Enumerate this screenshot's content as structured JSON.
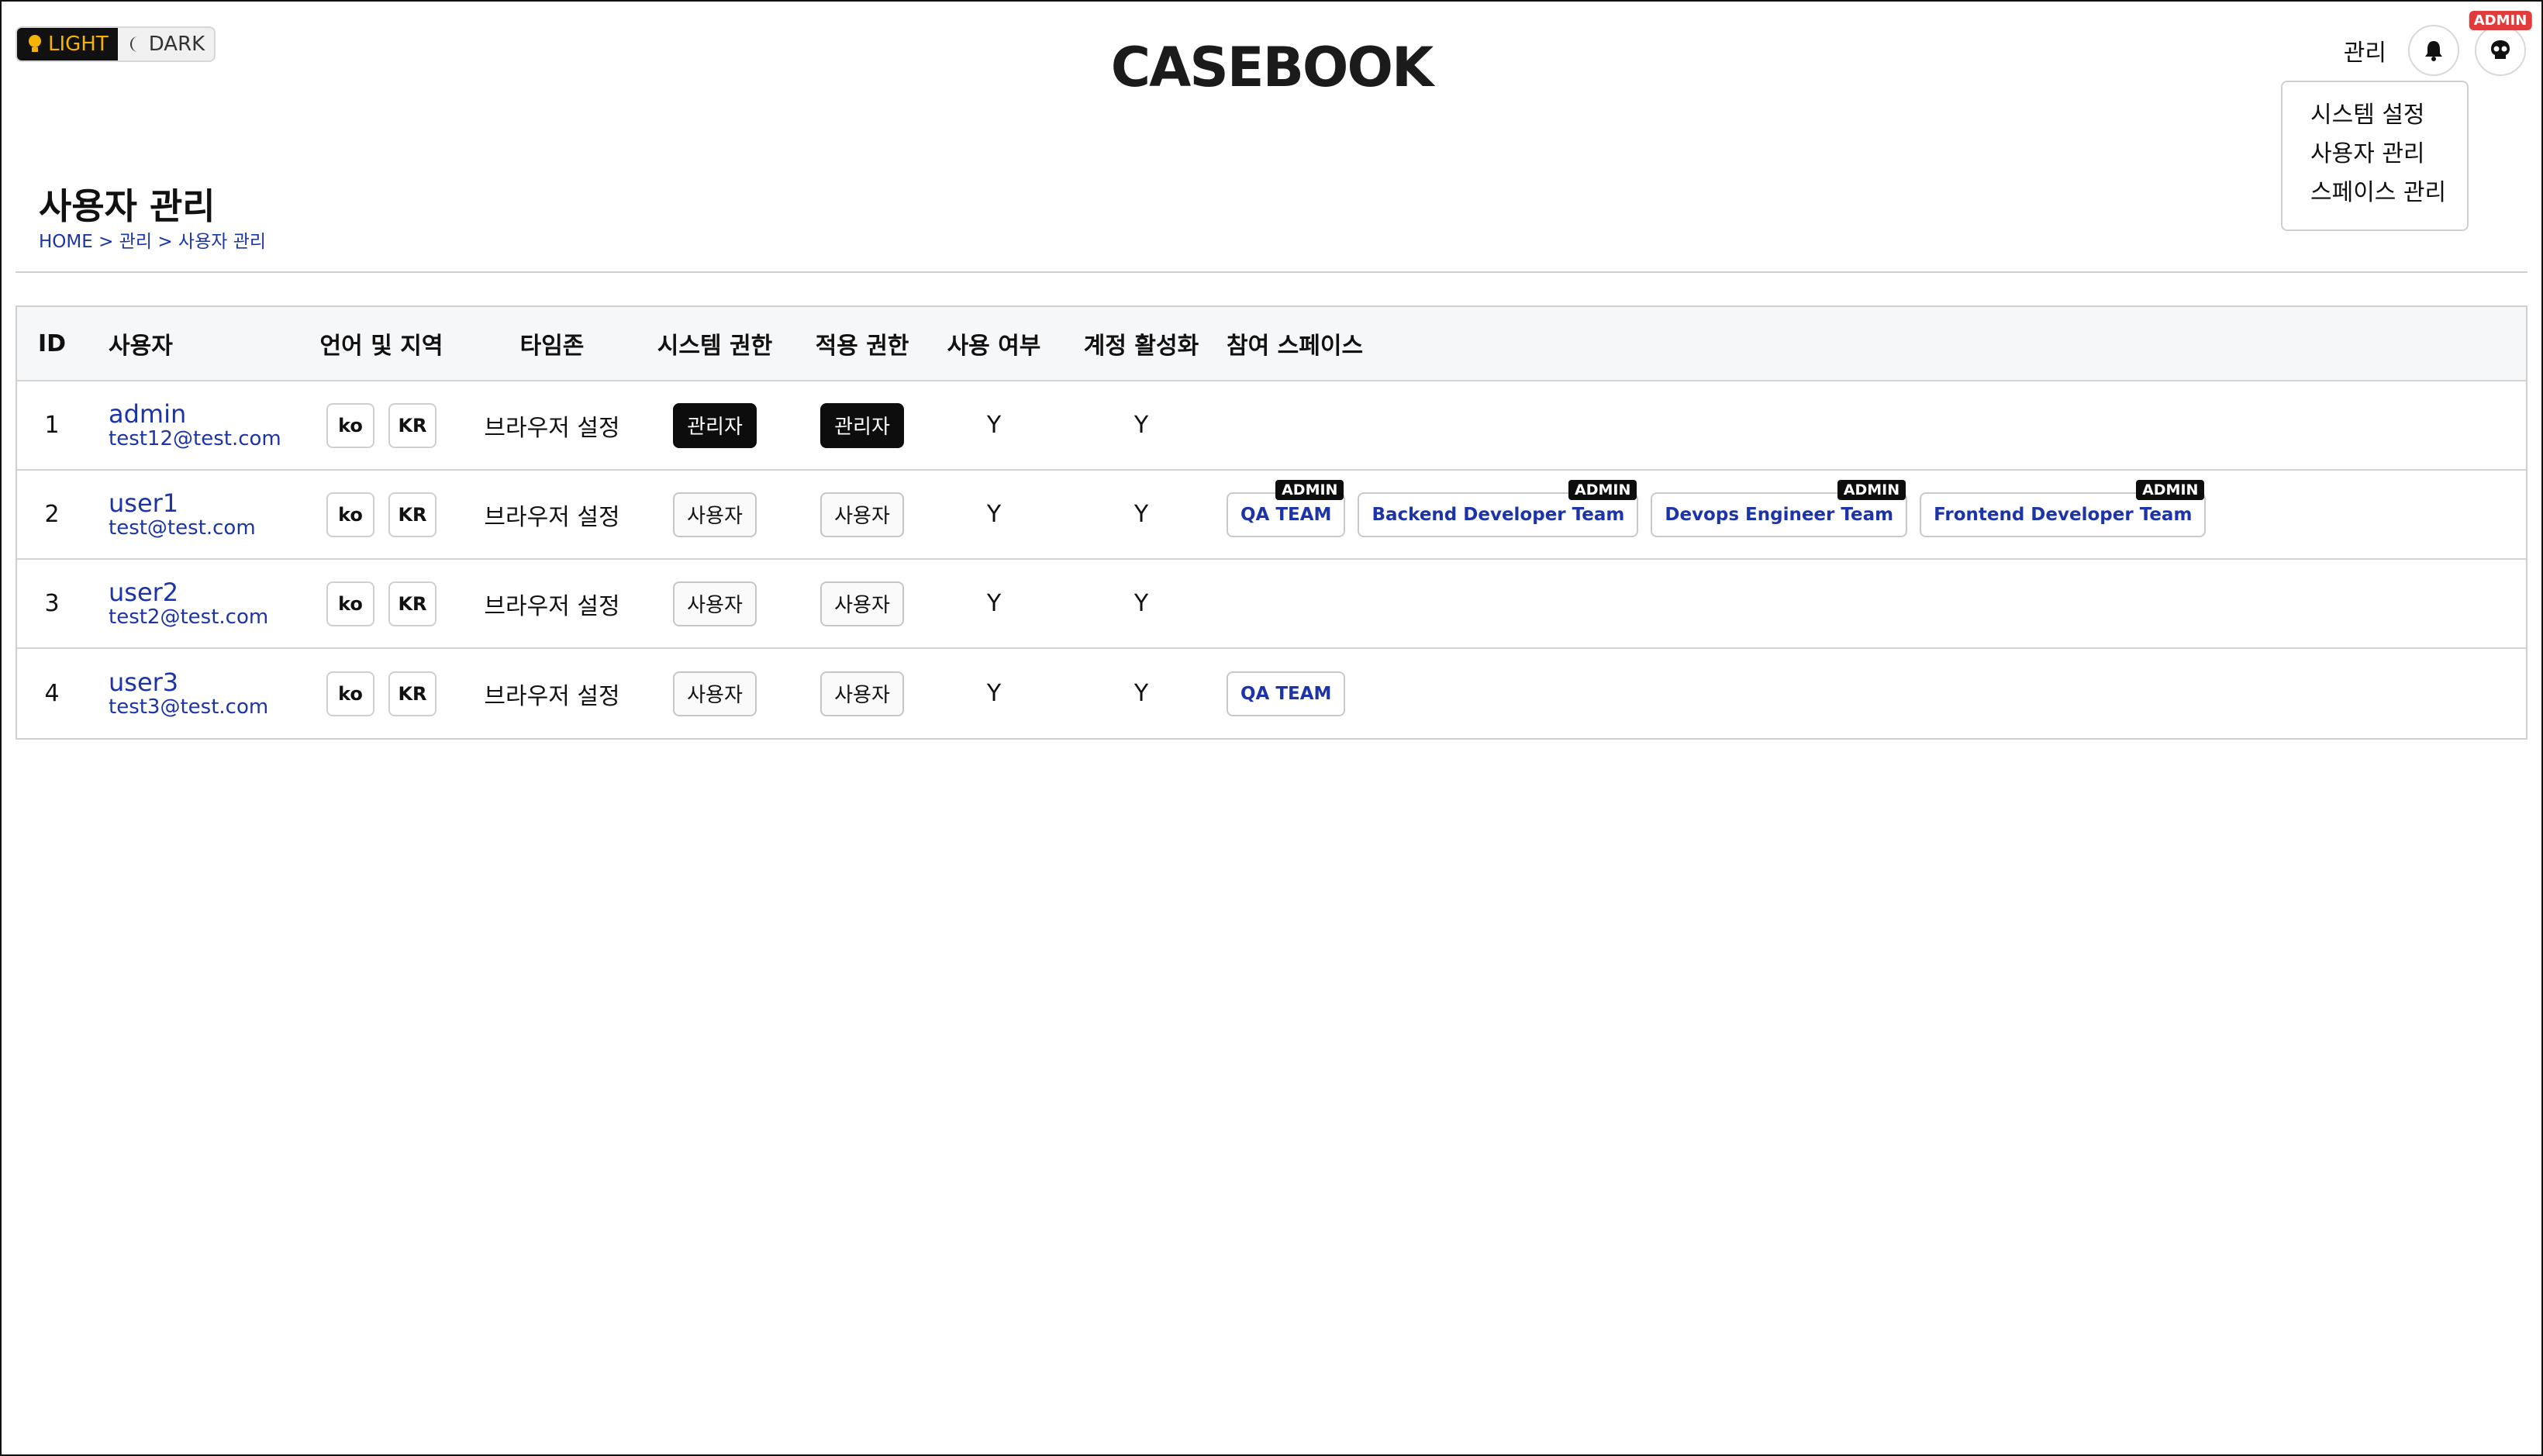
{
  "theme": {
    "light_label": "LIGHT",
    "dark_label": "DARK",
    "active": "light"
  },
  "app": {
    "logo": "CASEBOOK"
  },
  "header": {
    "manage_label": "관리",
    "admin_badge": "ADMIN"
  },
  "dropdown": {
    "items": [
      "시스템 설정",
      "사용자 관리",
      "스페이스 관리"
    ]
  },
  "page": {
    "title": "사용자 관리",
    "breadcrumb": [
      "HOME",
      "관리",
      "사용자 관리"
    ],
    "breadcrumb_sep": ">"
  },
  "table": {
    "headers": [
      "ID",
      "사용자",
      "언어 및 지역",
      "타임존",
      "시스템 권한",
      "적용 권한",
      "사용 여부",
      "계정 활성화",
      "참여 스페이스"
    ],
    "rows": [
      {
        "id": "1",
        "name": "admin",
        "email": "test12@test.com",
        "lang": "ko",
        "region": "KR",
        "timezone": "브라우저 설정",
        "system_role": "관리자",
        "applied_role": "관리자",
        "use": "Y",
        "active": "Y",
        "spaces": []
      },
      {
        "id": "2",
        "name": "user1",
        "email": "test@test.com",
        "lang": "ko",
        "region": "KR",
        "timezone": "브라우저 설정",
        "system_role": "사용자",
        "applied_role": "사용자",
        "use": "Y",
        "active": "Y",
        "spaces": [
          {
            "name": "QA TEAM",
            "badge": "ADMIN"
          },
          {
            "name": "Backend Developer Team",
            "badge": "ADMIN"
          },
          {
            "name": "Devops Engineer Team",
            "badge": "ADMIN"
          },
          {
            "name": "Frontend Developer Team",
            "badge": "ADMIN"
          }
        ]
      },
      {
        "id": "3",
        "name": "user2",
        "email": "test2@test.com",
        "lang": "ko",
        "region": "KR",
        "timezone": "브라우저 설정",
        "system_role": "사용자",
        "applied_role": "사용자",
        "use": "Y",
        "active": "Y",
        "spaces": []
      },
      {
        "id": "4",
        "name": "user3",
        "email": "test3@test.com",
        "lang": "ko",
        "region": "KR",
        "timezone": "브라우저 설정",
        "system_role": "사용자",
        "applied_role": "사용자",
        "use": "Y",
        "active": "Y",
        "spaces": [
          {
            "name": "QA TEAM",
            "badge": ""
          }
        ]
      }
    ]
  },
  "colors": {
    "accent": "#1d34a8",
    "badge_red": "#e23b3b",
    "admin_role_bg": "#0d0d0d"
  }
}
